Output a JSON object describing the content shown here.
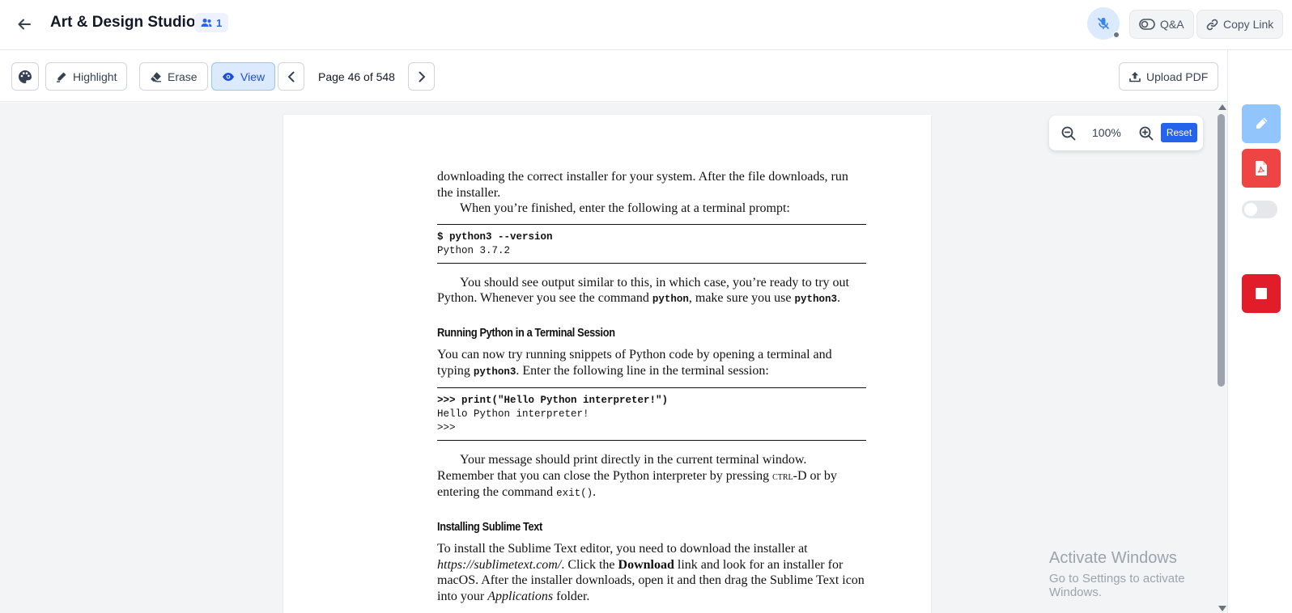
{
  "header": {
    "title": "Art & Design Studio",
    "participants_count": "1",
    "qa_label": "Q&A",
    "copy_link_label": "Copy Link"
  },
  "toolbar": {
    "highlight_label": "Highlight",
    "erase_label": "Erase",
    "view_label": "View",
    "page_indicator": "Page 46 of 548",
    "upload_label": "Upload PDF"
  },
  "zoom": {
    "level": "100%",
    "reset_label": "Reset"
  },
  "document": {
    "p1": "downloading the correct installer for your system. After the file downloads, run the installer.",
    "p2": "When you’re finished, enter the following at a terminal prompt:",
    "code1": {
      "line1": "$ python3 --version",
      "line2": "Python 3.7.2"
    },
    "p3_a": "You should see output similar to this, in which case, you’re ready to try out Python. Whenever you see the command ",
    "p3_code1": "python",
    "p3_b": ", make sure you use ",
    "p3_code2": "python3",
    "p3_c": ".",
    "h1": "Running Python in a Terminal Session",
    "p4_a": "You can now try running snippets of Python code by opening a terminal and typing ",
    "p4_code": "python3",
    "p4_b": ". Enter the following line in the terminal session:",
    "code2": {
      "line1": ">>> print(\"Hello Python interpreter!\")",
      "line2": "Hello Python interpreter!",
      "line3": ">>>"
    },
    "p5_a": "Your message should print directly in the current terminal window. Remember that you can close the Python interpreter by pressing ",
    "p5_key": "ctrl",
    "p5_b": "-D or by entering the command ",
    "p5_code": "exit()",
    "p5_c": ".",
    "h2": "Installing Sublime Text",
    "p6_a": "To install the Sublime Text editor, you need to download the installer at ",
    "p6_url": "https://sublimetext.com/",
    "p6_b": ". Click the ",
    "p6_bold": "Download",
    "p6_c": " link and look for an installer for macOS. After the installer downloads, open it and then drag the Sublime Text icon into your ",
    "p6_italic": "Applications",
    "p6_d": " folder."
  },
  "watermark": {
    "title": "Activate Windows",
    "subtitle": "Go to Settings to activate Windows."
  },
  "colors": {
    "accent": "#2563eb",
    "active_bg": "#dbeafe",
    "danger": "#ef4444",
    "stop": "#e11d2a"
  },
  "icons": [
    "back-arrow-icon",
    "users-icon",
    "mic-off-icon",
    "qa-icon",
    "link-icon",
    "palette-icon",
    "pen-icon",
    "eraser-icon",
    "eye-icon",
    "chevron-left-icon",
    "chevron-right-icon",
    "upload-icon",
    "zoom-out-icon",
    "zoom-in-icon",
    "pdf-file-icon",
    "stop-icon"
  ]
}
